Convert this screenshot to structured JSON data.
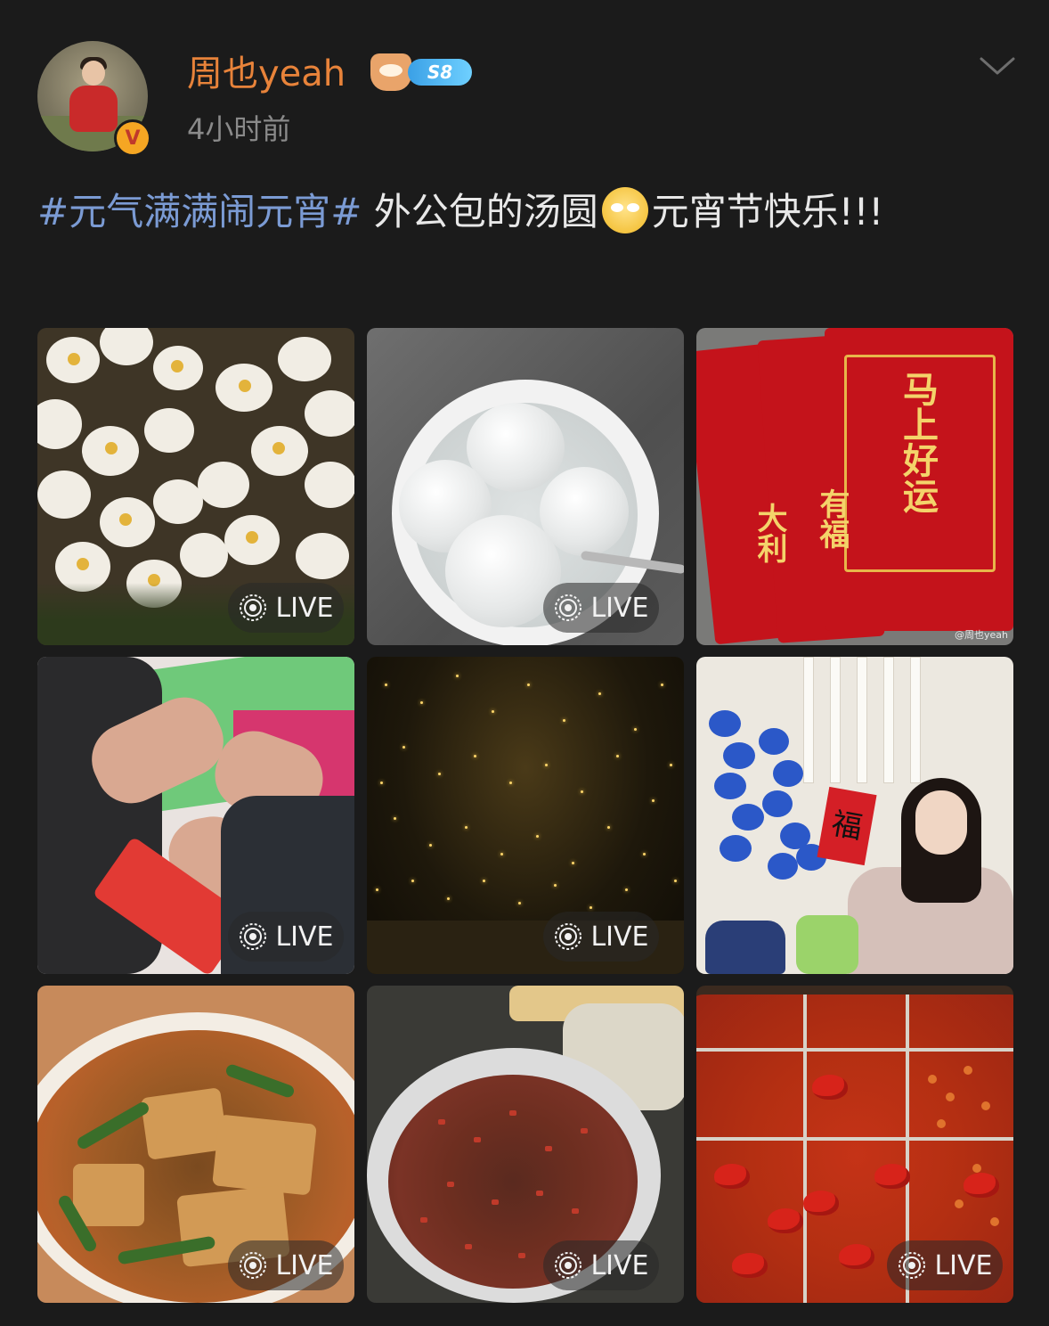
{
  "post": {
    "username": "周也yeah",
    "level_badge": "S8",
    "timestamp": "4小时前",
    "hashtag": "#元气满满闹元宵#",
    "text_before_emoji": " 外公包的汤圆",
    "text_after_emoji": "元宵节快乐!!!"
  },
  "icons": {
    "avatar": "avatar",
    "verified": "verified-v-icon",
    "level": "level-badge-icon",
    "more": "chevron-down-icon",
    "live": "live-photo-icon",
    "emoji": "emoji-face"
  },
  "images": {
    "live_label": "LIVE",
    "watermark": "@周也yeah",
    "envelope_texts": [
      "马上好运",
      "有福",
      "大利"
    ]
  },
  "colors": {
    "background": "#1b1b1b",
    "username": "#e8833a",
    "hashtag": "#7b9bd4",
    "timestamp": "#8a8a8a",
    "verified_badge": "#f5a623"
  }
}
